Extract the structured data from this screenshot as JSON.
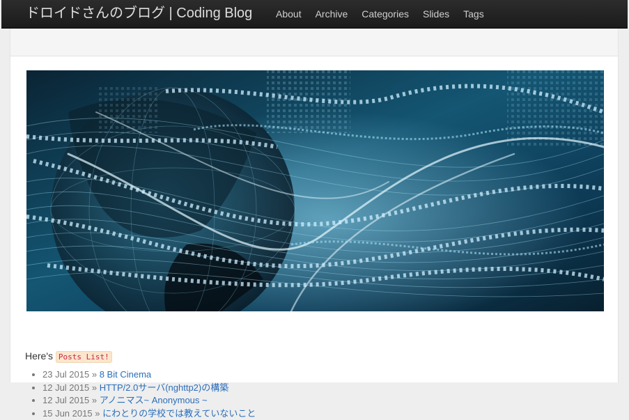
{
  "navbar": {
    "brand": "ドロイドさんのブログ | Coding Blog",
    "items": [
      "About",
      "Archive",
      "Categories",
      "Slides",
      "Tags"
    ]
  },
  "intro": {
    "prefix": "Here's",
    "code": "Posts List!"
  },
  "posts": [
    {
      "date": "23 Jul 2015",
      "sep": "»",
      "title": "8 Bit Cinema"
    },
    {
      "date": "12 Jul 2015",
      "sep": "»",
      "title": "HTTP/2.0サーバ(nghttp2)の構築"
    },
    {
      "date": "12 Jul 2015",
      "sep": "»",
      "title": "アノニマス~ Anonymous ~"
    },
    {
      "date": "15 Jun 2015",
      "sep": "»",
      "title": "にわとりの学校では教えていないこと"
    }
  ],
  "colors": {
    "navbar_bg": "#222222",
    "link": "#2a6ebb",
    "code_bg": "#fbe6cb"
  }
}
